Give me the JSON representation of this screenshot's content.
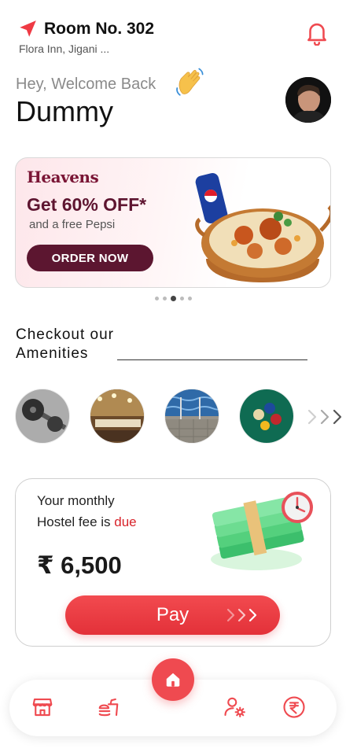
{
  "header": {
    "room": "Room No. 302",
    "location": "Flora Inn, Jigani ..."
  },
  "greeting": {
    "hey": "Hey, Welcome Back",
    "name": "Dummy"
  },
  "banner": {
    "brand": "Heavens",
    "offer": "Get 60% OFF*",
    "sub": "and a free Pepsi",
    "cta": "ORDER NOW",
    "carousel_pages": 5,
    "carousel_active": 3
  },
  "amenities": {
    "title_line1": "Checkout our",
    "title_line2": "Amenities",
    "items": [
      "gym-icon",
      "event-hall-icon",
      "swimming-pool-icon",
      "billiards-icon"
    ]
  },
  "fee": {
    "line1": "Your monthly",
    "line2_prefix": "Hostel fee is ",
    "line2_status": "due",
    "amount": "₹ 6,500",
    "pay_label": "Pay"
  },
  "nav": {
    "items": [
      "store-icon",
      "food-icon",
      "home-icon",
      "profile-settings-icon",
      "payment-icon"
    ]
  },
  "colors": {
    "accent": "#ef4a50",
    "brand_maroon": "#5c1630",
    "due_red": "#d8232a"
  }
}
